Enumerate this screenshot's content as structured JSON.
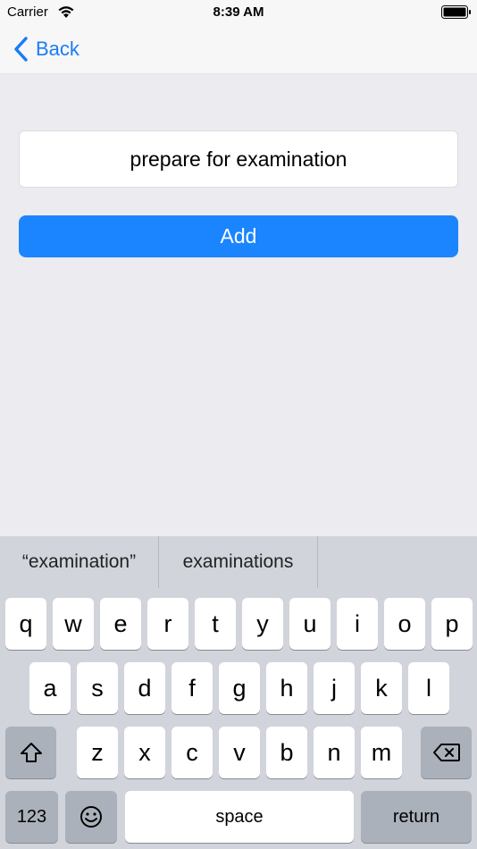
{
  "status_bar": {
    "carrier": "Carrier",
    "time": "8:39 AM"
  },
  "nav": {
    "back_label": "Back"
  },
  "form": {
    "task_value": "prepare for examination",
    "add_label": "Add"
  },
  "keyboard": {
    "suggestions": [
      "“examination”",
      "examinations",
      ""
    ],
    "row1": [
      "q",
      "w",
      "e",
      "r",
      "t",
      "y",
      "u",
      "i",
      "o",
      "p"
    ],
    "row2": [
      "a",
      "s",
      "d",
      "f",
      "g",
      "h",
      "j",
      "k",
      "l"
    ],
    "row3": [
      "z",
      "x",
      "c",
      "v",
      "b",
      "n",
      "m"
    ],
    "numbers_label": "123",
    "space_label": "space",
    "return_label": "return"
  },
  "colors": {
    "accent": "#1a85ff",
    "keyboard_bg": "#d1d4da"
  }
}
